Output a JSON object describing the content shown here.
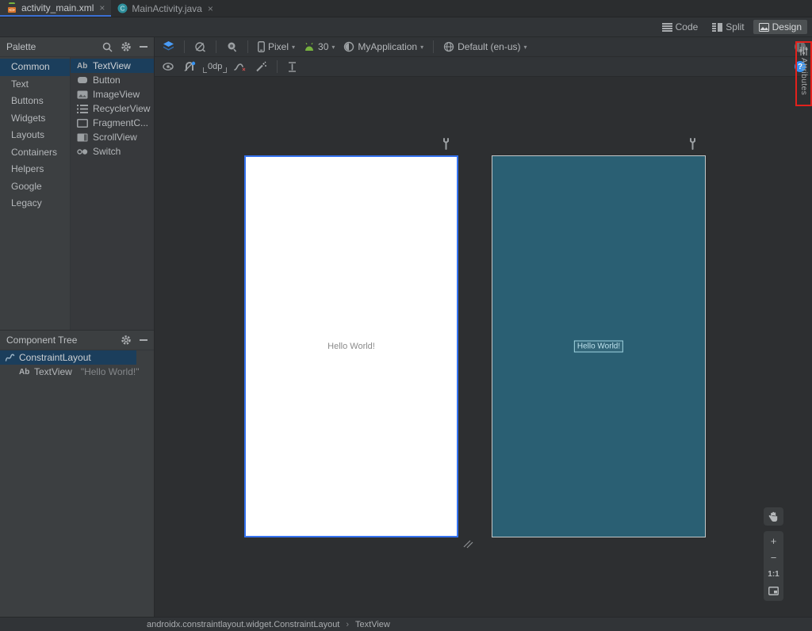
{
  "tabs": [
    {
      "label": "activity_main.xml",
      "close": "×"
    },
    {
      "label": "MainActivity.java",
      "close": "×",
      "icon_letter": "C"
    }
  ],
  "view_modes": {
    "code": "Code",
    "split": "Split",
    "design": "Design"
  },
  "palette": {
    "title": "Palette",
    "categories": [
      "Common",
      "Text",
      "Buttons",
      "Widgets",
      "Layouts",
      "Containers",
      "Helpers",
      "Google",
      "Legacy"
    ],
    "items": [
      {
        "prefix": "Ab",
        "label": "TextView"
      },
      {
        "label": "Button"
      },
      {
        "label": "ImageView"
      },
      {
        "label": "RecyclerView"
      },
      {
        "label": "FragmentC..."
      },
      {
        "label": "ScrollView"
      },
      {
        "label": "Switch"
      }
    ]
  },
  "component_tree": {
    "title": "Component Tree",
    "root": "ConstraintLayout",
    "child_prefix": "Ab",
    "child": "TextView",
    "child_value": "\"Hello World!\""
  },
  "design_toolbar": {
    "device": "Pixel",
    "api": "30",
    "app": "MyApplication",
    "locale": "Default (en-us)",
    "chevron": "▾",
    "error_indicator": "!"
  },
  "constraint_toolbar": {
    "margin": "0dp",
    "help_indicator": "?",
    "clear_x": "×"
  },
  "canvas": {
    "hello_design": "Hello World!",
    "hello_blueprint": "Hello World!"
  },
  "zoom_controls": {
    "zoom_in": "+",
    "zoom_out": "−",
    "actual_size": "1:1"
  },
  "attributes_tab": {
    "label": "Attributes"
  },
  "breadcrumb": {
    "path": "androidx.constraintlayout.widget.ConstraintLayout",
    "separator": "›",
    "current": "TextView"
  },
  "colors": {
    "blueprint_fill": "#2a5f73",
    "design_border": "#3573f0",
    "annotation_red": "#e2211c",
    "tab_underline": "#3b6fd4",
    "selection": "#1b3e5c"
  }
}
